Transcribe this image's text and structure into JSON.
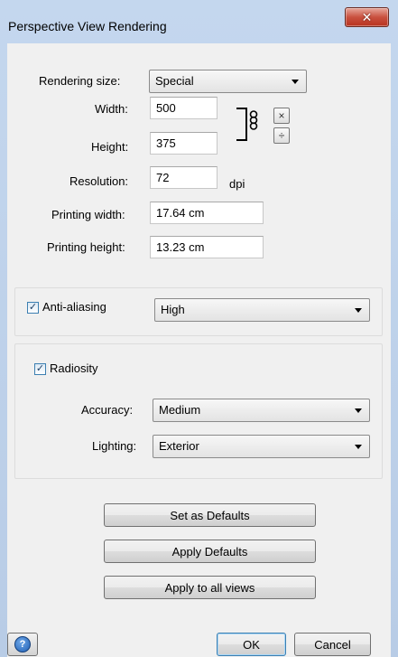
{
  "window": {
    "title": "Perspective View Rendering",
    "close_glyph": "✕"
  },
  "size": {
    "rendering_size_label": "Rendering size:",
    "rendering_size_value": "Special",
    "width_label": "Width:",
    "width_value": "500",
    "height_label": "Height:",
    "height_value": "375",
    "resolution_label": "Resolution:",
    "resolution_value": "72",
    "resolution_unit": "dpi",
    "printing_width_label": "Printing width:",
    "printing_width_value": "17.64 cm",
    "printing_height_label": "Printing height:",
    "printing_height_value": "13.23 cm",
    "link_icon": "chain-link-icon",
    "multiply_glyph": "×",
    "divide_glyph": "÷"
  },
  "antialiasing": {
    "label": "Anti-aliasing",
    "checked": true,
    "value": "High"
  },
  "radiosity": {
    "label": "Radiosity",
    "checked": true,
    "accuracy_label": "Accuracy:",
    "accuracy_value": "Medium",
    "lighting_label": "Lighting:",
    "lighting_value": "Exterior"
  },
  "actions": {
    "set_defaults": "Set as Defaults",
    "apply_defaults": "Apply Defaults",
    "apply_all": "Apply to all views"
  },
  "footer": {
    "help_glyph": "?",
    "ok": "OK",
    "cancel": "Cancel"
  },
  "colors": {
    "accent": "#3c7fb1",
    "close": "#c9513f"
  }
}
